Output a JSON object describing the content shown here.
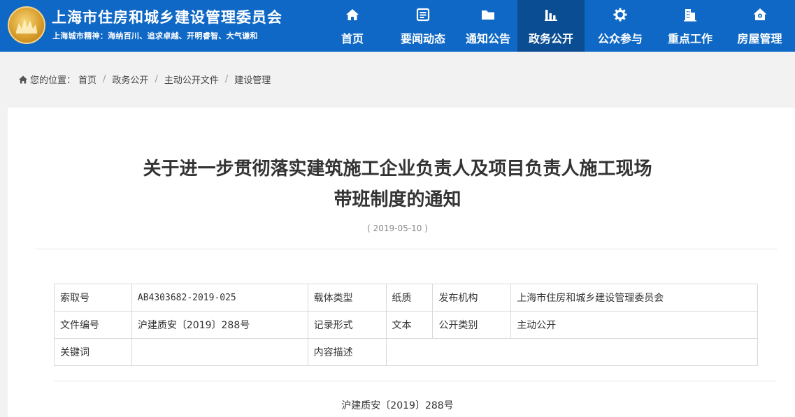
{
  "header": {
    "site_title": "上海市住房和城乡建设管理委员会",
    "motto": "上海城市精神：海纳百川、追求卓越、开明睿智、大气谦和",
    "brand_color": "#0f68c5",
    "active_color": "#0a4d92"
  },
  "nav": {
    "items": [
      {
        "label": "首页",
        "icon": "home-icon"
      },
      {
        "label": "要闻动态",
        "icon": "news-icon"
      },
      {
        "label": "通知公告",
        "icon": "folder-icon"
      },
      {
        "label": "政务公开",
        "icon": "chart-icon",
        "active": true
      },
      {
        "label": "公众参与",
        "icon": "gear-icon"
      },
      {
        "label": "重点工作",
        "icon": "building-icon"
      },
      {
        "label": "房屋管理",
        "icon": "house-icon"
      }
    ]
  },
  "breadcrumb": {
    "prefix": "您的位置：",
    "items": [
      "首页",
      "政务公开",
      "主动公开文件",
      "建设管理"
    ]
  },
  "article": {
    "title_line1": "关于进一步贯彻落实建筑施工企业负责人及项目负责人施工现场",
    "title_line2": "带班制度的通知",
    "date": "( 2019-05-10 )",
    "doc_number": "沪建质安〔2019〕288号"
  },
  "meta_table": {
    "rows": [
      [
        "索取号",
        "AB4303682-2019-025",
        "载体类型",
        "纸质",
        "发布机构",
        "上海市住房和城乡建设管理委员会"
      ],
      [
        "文件编号",
        "沪建质安〔2019〕288号",
        "记录形式",
        "文本",
        "公开类别",
        "主动公开"
      ],
      [
        "关键词",
        "",
        "内容描述",
        ""
      ]
    ]
  }
}
